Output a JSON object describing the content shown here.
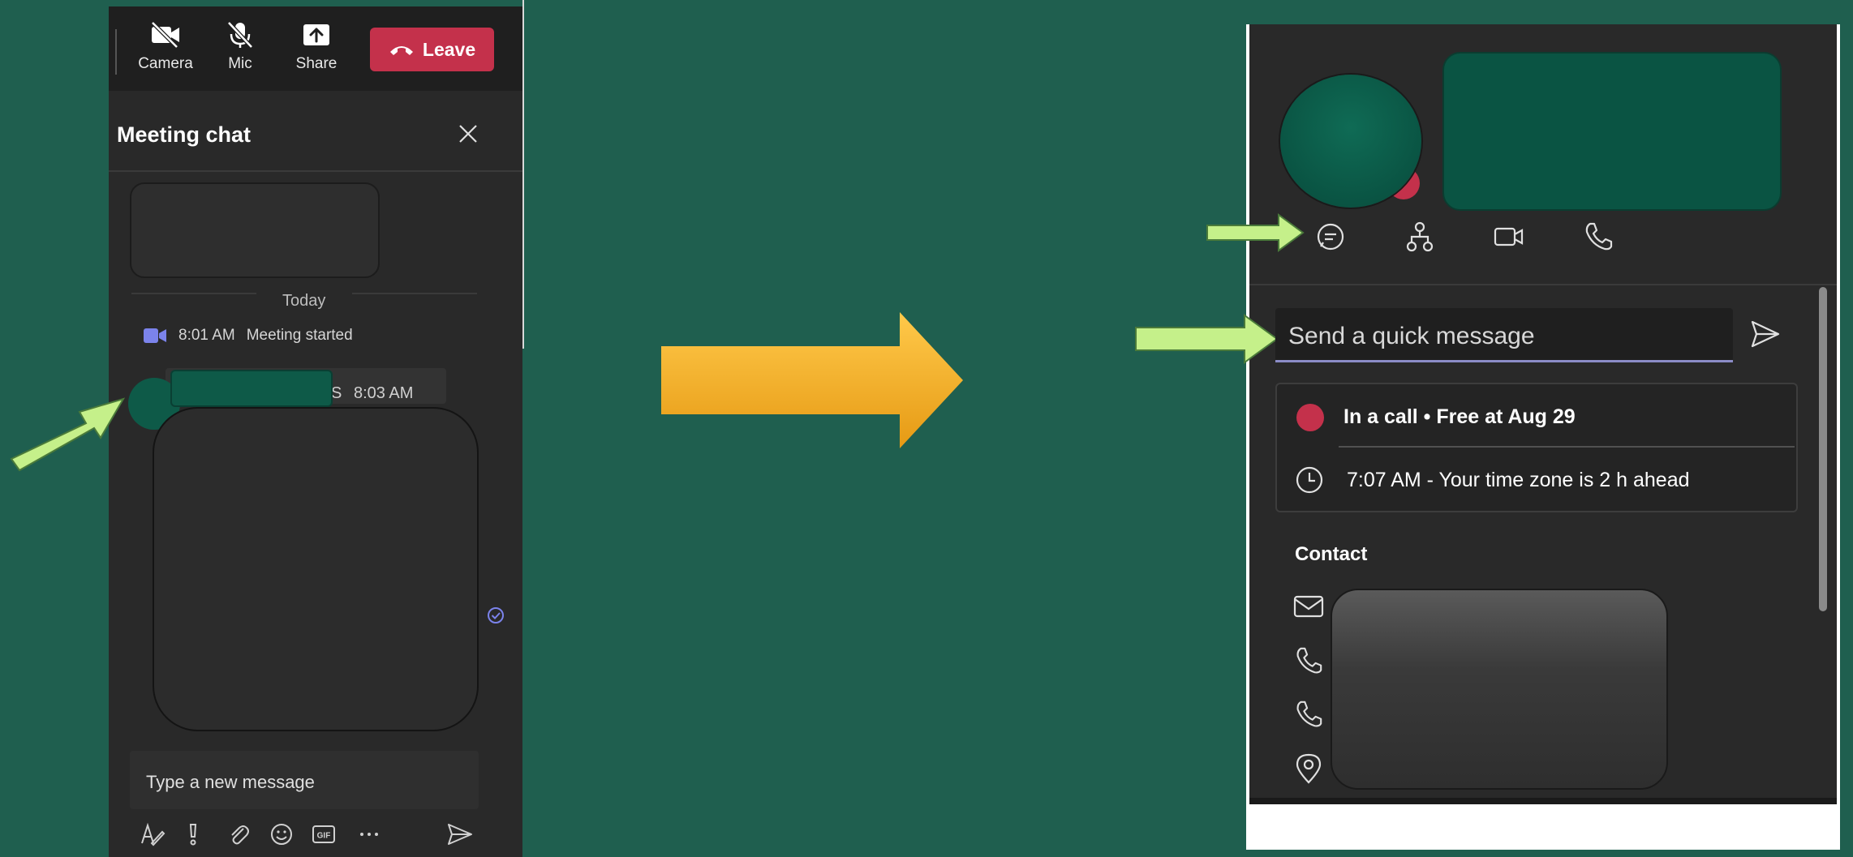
{
  "toolbar": {
    "camera_label": "Camera",
    "mic_label": "Mic",
    "share_label": "Share",
    "leave_label": "Leave"
  },
  "chat": {
    "title": "Meeting chat",
    "date_divider": "Today",
    "event": {
      "time": "8:01 AM",
      "text": "Meeting started"
    },
    "message": {
      "sender_suffix": "S",
      "time": "8:03 AM"
    },
    "compose_placeholder": "Type a new message"
  },
  "profile": {
    "quick_message_placeholder": "Send a quick message",
    "status": "In a call • Free at Aug 29",
    "local_time": "7:07 AM - Your time zone is 2 h ahead",
    "contact_heading": "Contact"
  },
  "colors": {
    "background": "#1f5f4f",
    "panel": "#292929",
    "leave_red": "#c4314b",
    "accent_arrow": "#f5b431",
    "pointer_arrow": "#c5f08a"
  },
  "icons": [
    "camera-off-icon",
    "mic-off-icon",
    "share-icon",
    "phone-hangup-icon",
    "close-icon",
    "meeting-video-icon",
    "read-receipt-icon",
    "format-icon",
    "priority-icon",
    "attach-icon",
    "emoji-icon",
    "gif-icon",
    "more-icon",
    "send-icon",
    "chat-icon",
    "org-chart-icon",
    "video-call-icon",
    "audio-call-icon",
    "clock-icon",
    "mail-icon",
    "phone-icon",
    "location-icon"
  ]
}
